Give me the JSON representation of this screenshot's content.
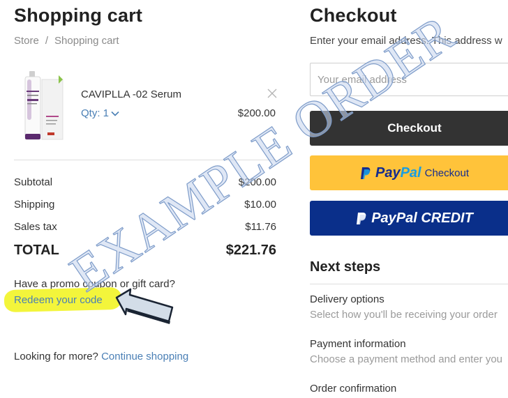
{
  "cart": {
    "title": "Shopping cart",
    "breadcrumb": [
      "Store",
      "/",
      "Shopping cart"
    ],
    "item": {
      "name": "CAVIPLLA -02 Serum",
      "qty_label": "Qty: 1",
      "price": "$200.00"
    },
    "summary": {
      "subtotal_label": "Subtotal",
      "subtotal": "$200.00",
      "shipping_label": "Shipping",
      "shipping": "$10.00",
      "tax_label": "Sales tax",
      "tax": "$11.76",
      "total_label": "TOTAL",
      "total": "$221.76"
    },
    "promo_question": "Have a promo coupon or gift card?",
    "redeem_link": "Redeem your code",
    "looking_text": "Looking for more?",
    "continue_link": "Continue shopping"
  },
  "checkout": {
    "title": "Checkout",
    "email_hint": "Enter your email address. This address w",
    "email_placeholder": "Your email address",
    "checkout_button": "Checkout",
    "paypal_pay": "Pay",
    "paypal_pal": "Pal",
    "paypal_checkout": "Checkout",
    "paypal_credit": "PayPal CREDIT",
    "next_steps_title": "Next steps",
    "steps": [
      {
        "title": "Delivery options",
        "desc": "Select how you'll be receiving your order"
      },
      {
        "title": "Payment information",
        "desc": "Choose a payment method and enter you"
      },
      {
        "title": "Order confirmation",
        "desc": ""
      }
    ]
  },
  "watermark": "EXAMPLE ORDER",
  "icons": {
    "remove": "close-icon",
    "qty": "chevron-down-icon",
    "paypal": "paypal-logo-icon",
    "annotation": "arrow-icon"
  },
  "colors": {
    "link": "#4a7fb5",
    "checkout_button": "#333333",
    "paypal_button": "#ffc33a",
    "paypal_credit_button": "#0a2f8a",
    "highlight": "#f3f53b",
    "watermark": "#a9bfe3"
  }
}
